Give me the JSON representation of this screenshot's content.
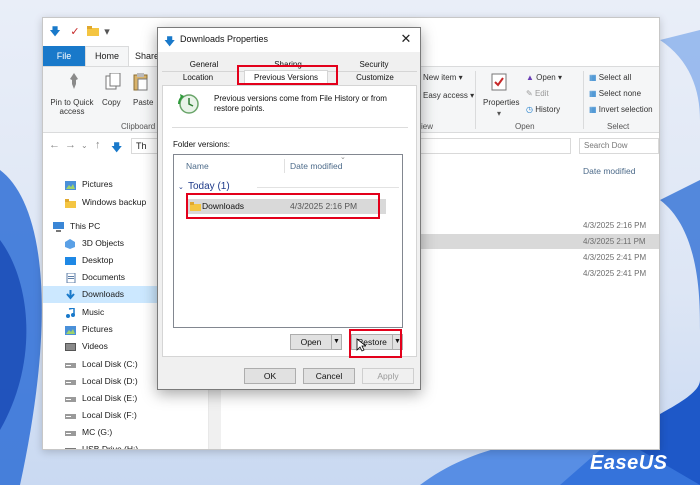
{
  "explorer": {
    "tabs": {
      "file": "File",
      "home": "Home",
      "share": "Share"
    },
    "ribbon": {
      "pin_label": "Pin to Quick access",
      "copy_label": "Copy",
      "paste_label": "Paste",
      "clipboard_group": "Clipboard",
      "new_item": "New item",
      "easy_access": "Easy access",
      "view_group_fragment": "iew",
      "properties_label": "Properties",
      "open_label": "Open",
      "edit_label": "Edit",
      "history_label": "History",
      "open_group": "Open",
      "select_all": "Select all",
      "select_none": "Select none",
      "invert_selection": "Invert selection",
      "select_group": "Select"
    },
    "address": {
      "path_fragment": "Th",
      "search_placeholder": "Search Dow"
    },
    "nav_items": [
      {
        "label": "Pictures",
        "icon": "pictures-icon"
      },
      {
        "label": "Windows backup",
        "icon": "folder-icon"
      },
      {
        "label": "This PC",
        "icon": "pc-icon"
      },
      {
        "label": "3D Objects",
        "icon": "3d-objects-icon"
      },
      {
        "label": "Desktop",
        "icon": "desktop-icon"
      },
      {
        "label": "Documents",
        "icon": "documents-icon"
      },
      {
        "label": "Downloads",
        "icon": "downloads-icon"
      },
      {
        "label": "Music",
        "icon": "music-icon"
      },
      {
        "label": "Pictures",
        "icon": "pictures-icon"
      },
      {
        "label": "Videos",
        "icon": "videos-icon"
      },
      {
        "label": "Local Disk (C:)",
        "icon": "drive-icon"
      },
      {
        "label": "Local Disk (D:)",
        "icon": "drive-icon"
      },
      {
        "label": "Local Disk (E:)",
        "icon": "drive-icon"
      },
      {
        "label": "Local Disk (F:)",
        "icon": "drive-icon"
      },
      {
        "label": "MC (G:)",
        "icon": "drive-icon"
      },
      {
        "label": "USB Drive (H:)",
        "icon": "usb-drive-icon"
      }
    ],
    "content": {
      "date_modified_header": "Date modified",
      "rows": [
        "4/3/2025 2:16 PM",
        "4/3/2025 2:11 PM",
        "4/3/2025 2:41 PM",
        "4/3/2025 2:41 PM"
      ]
    }
  },
  "dialog": {
    "title": "Downloads Properties",
    "tabs": {
      "general": "General",
      "sharing": "Sharing",
      "security": "Security",
      "location": "Location",
      "previous_versions": "Previous Versions",
      "customize": "Customize"
    },
    "description": "Previous versions come from File History or from restore points.",
    "folder_versions_label": "Folder versions:",
    "columns": {
      "name": "Name",
      "date_modified": "Date modified"
    },
    "group": "Today (1)",
    "version_row": {
      "name": "Downloads",
      "date": "4/3/2025 2:16 PM"
    },
    "buttons": {
      "open": "Open",
      "restore": "Restore",
      "ok": "OK",
      "cancel": "Cancel",
      "apply": "Apply"
    }
  },
  "brand": "EaseUS",
  "colors": {
    "accent": "#1979ca",
    "highlight_red": "#e3001b",
    "selection": "#cce8ff"
  }
}
